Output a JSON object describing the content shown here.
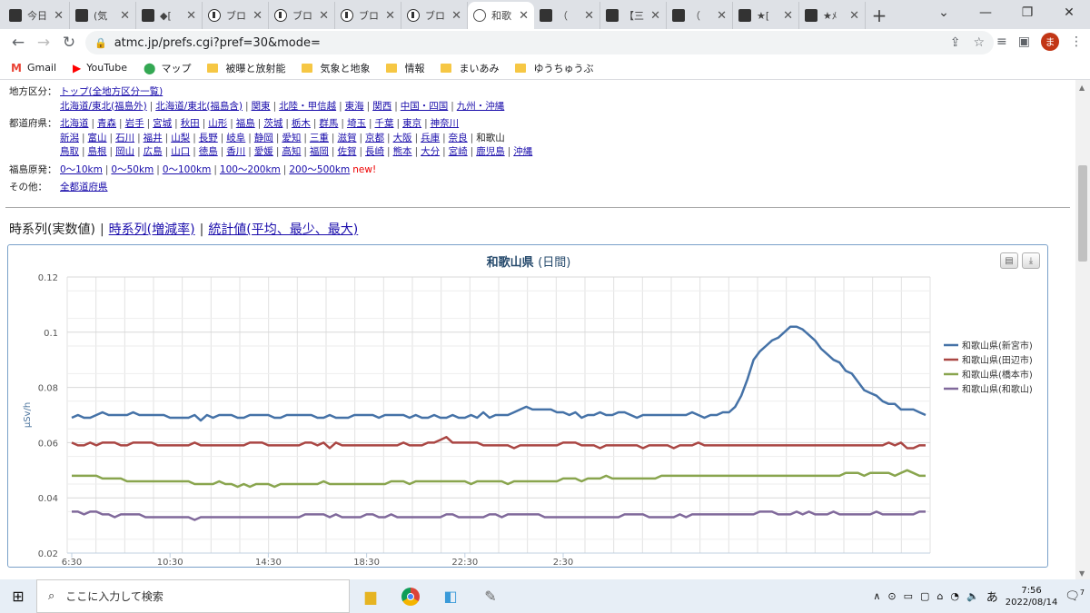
{
  "browser": {
    "tabs": [
      {
        "title": "今日",
        "icon": "site-icon"
      },
      {
        "title": "(気",
        "icon": "site-icon"
      },
      {
        "title": "◆[",
        "icon": "site-icon"
      },
      {
        "title": "ブロ",
        "icon": "blog-icon"
      },
      {
        "title": "ブロ",
        "icon": "blog-icon"
      },
      {
        "title": "ブロ",
        "icon": "blog-icon"
      },
      {
        "title": "ブロ",
        "icon": "blog-icon"
      },
      {
        "title": "和歌",
        "icon": "globe-icon",
        "active": true
      },
      {
        "title": "（",
        "icon": "site-icon"
      },
      {
        "title": "【三",
        "icon": "site-icon"
      },
      {
        "title": "（",
        "icon": "site-icon"
      },
      {
        "title": "★[",
        "icon": "site-icon"
      },
      {
        "title": "★ﾒ",
        "icon": "site-icon"
      }
    ],
    "url": "atmc.jp/prefs.cgi?pref=30&mode=",
    "profile_initial": "ま",
    "bookmarks": [
      {
        "label": "Gmail",
        "icon": "gmail-icon"
      },
      {
        "label": "YouTube",
        "icon": "youtube-icon"
      },
      {
        "label": "マップ",
        "icon": "maps-icon"
      },
      {
        "label": "被曝と放射能",
        "icon": "folder-icon"
      },
      {
        "label": "気象と地象",
        "icon": "folder-icon"
      },
      {
        "label": "情報",
        "icon": "folder-icon"
      },
      {
        "label": "まいあみ",
        "icon": "folder-icon"
      },
      {
        "label": "ゆうちゅうぶ",
        "icon": "folder-icon"
      }
    ]
  },
  "nav": {
    "region_label": "地方区分：",
    "region_row1": [
      "トップ(全地方区分一覧)"
    ],
    "region_row2": [
      "北海道/東北(福島外)",
      "北海道/東北(福島含)",
      "関東",
      "北陸・甲信越",
      "東海",
      "関西",
      "中国・四国",
      "九州・沖縄"
    ],
    "pref_label": "都道府県：",
    "pref_row1": [
      "北海道",
      "青森",
      "岩手",
      "宮城",
      "秋田",
      "山形",
      "福島",
      "茨城",
      "栃木",
      "群馬",
      "埼玉",
      "千葉",
      "東京",
      "神奈川"
    ],
    "pref_row2": [
      "新潟",
      "富山",
      "石川",
      "福井",
      "山梨",
      "長野",
      "岐阜",
      "静岡",
      "愛知",
      "三重",
      "滋賀",
      "京都",
      "大阪",
      "兵庫",
      "奈良"
    ],
    "pref_row2_current": "和歌山",
    "pref_row3": [
      "鳥取",
      "島根",
      "岡山",
      "広島",
      "山口",
      "徳島",
      "香川",
      "愛媛",
      "高知",
      "福岡",
      "佐賀",
      "長崎",
      "熊本",
      "大分",
      "宮崎",
      "鹿児島",
      "沖縄"
    ],
    "fukushima_label": "福島原発：",
    "fukushima_links": [
      "0〜10km",
      "0〜50km",
      "0〜100km",
      "100〜200km",
      "200〜500km"
    ],
    "new_label": "new!",
    "other_label": "その他：",
    "other_links": [
      "全都道府県"
    ]
  },
  "modes": {
    "current": "時系列(実数値)",
    "links": [
      "時系列(増減率)",
      "統計値(平均、最少、最大)"
    ]
  },
  "chart_data": {
    "type": "line",
    "title": "和歌山県",
    "subtitle": "(日間)",
    "ylabel": "μSv/h",
    "ylim": [
      0.02,
      0.12
    ],
    "yticks": [
      "0.02",
      "0.04",
      "0.06",
      "0.08",
      "0.1",
      "0.12"
    ],
    "xticks": [
      "6:30",
      "10:30",
      "14:30",
      "18:30",
      "22:30",
      "2:30"
    ],
    "colors": [
      "#4572a7",
      "#aa4643",
      "#89a54e",
      "#80699b"
    ],
    "legend_position": "right",
    "series": [
      {
        "name": "和歌山県(新宮市)",
        "values": [
          0.069,
          0.07,
          0.069,
          0.069,
          0.07,
          0.071,
          0.07,
          0.07,
          0.07,
          0.07,
          0.071,
          0.07,
          0.07,
          0.07,
          0.07,
          0.07,
          0.069,
          0.069,
          0.069,
          0.069,
          0.07,
          0.068,
          0.07,
          0.069,
          0.07,
          0.07,
          0.07,
          0.069,
          0.069,
          0.07,
          0.07,
          0.07,
          0.07,
          0.069,
          0.069,
          0.07,
          0.07,
          0.07,
          0.07,
          0.07,
          0.069,
          0.069,
          0.07,
          0.069,
          0.069,
          0.069,
          0.07,
          0.07,
          0.07,
          0.07,
          0.069,
          0.07,
          0.07,
          0.07,
          0.07,
          0.069,
          0.07,
          0.069,
          0.069,
          0.07,
          0.069,
          0.069,
          0.07,
          0.069,
          0.069,
          0.07,
          0.069,
          0.071,
          0.069,
          0.07,
          0.07,
          0.07,
          0.071,
          0.072,
          0.073,
          0.072,
          0.072,
          0.072,
          0.072,
          0.071,
          0.071,
          0.07,
          0.071,
          0.069,
          0.07,
          0.07,
          0.071,
          0.07,
          0.07,
          0.071,
          0.071,
          0.07,
          0.069,
          0.07,
          0.07,
          0.07,
          0.07,
          0.07,
          0.07,
          0.07,
          0.07,
          0.071,
          0.07,
          0.069,
          0.07,
          0.07,
          0.071,
          0.071,
          0.073,
          0.077,
          0.083,
          0.09,
          0.093,
          0.095,
          0.097,
          0.098,
          0.1,
          0.102,
          0.102,
          0.101,
          0.099,
          0.097,
          0.094,
          0.092,
          0.09,
          0.089,
          0.086,
          0.085,
          0.082,
          0.079,
          0.078,
          0.077,
          0.075,
          0.074,
          0.074,
          0.072,
          0.072,
          0.072,
          0.071,
          0.07
        ]
      },
      {
        "name": "和歌山県(田辺市)",
        "values": [
          0.06,
          0.059,
          0.059,
          0.06,
          0.059,
          0.06,
          0.06,
          0.06,
          0.059,
          0.059,
          0.06,
          0.06,
          0.06,
          0.06,
          0.059,
          0.059,
          0.059,
          0.059,
          0.059,
          0.059,
          0.06,
          0.059,
          0.059,
          0.059,
          0.059,
          0.059,
          0.059,
          0.059,
          0.059,
          0.06,
          0.06,
          0.06,
          0.059,
          0.059,
          0.059,
          0.059,
          0.059,
          0.059,
          0.06,
          0.06,
          0.059,
          0.06,
          0.058,
          0.06,
          0.059,
          0.059,
          0.059,
          0.059,
          0.059,
          0.059,
          0.059,
          0.059,
          0.059,
          0.059,
          0.06,
          0.059,
          0.059,
          0.059,
          0.06,
          0.06,
          0.061,
          0.062,
          0.06,
          0.06,
          0.06,
          0.06,
          0.06,
          0.059,
          0.059,
          0.059,
          0.059,
          0.059,
          0.058,
          0.059,
          0.059,
          0.059,
          0.059,
          0.059,
          0.059,
          0.059,
          0.06,
          0.06,
          0.06,
          0.059,
          0.059,
          0.059,
          0.058,
          0.059,
          0.059,
          0.059,
          0.059,
          0.059,
          0.059,
          0.058,
          0.059,
          0.059,
          0.059,
          0.059,
          0.058,
          0.059,
          0.059,
          0.059,
          0.06,
          0.059,
          0.059,
          0.059,
          0.059,
          0.059,
          0.059,
          0.059,
          0.059,
          0.059,
          0.059,
          0.059,
          0.059,
          0.059,
          0.059,
          0.059,
          0.059,
          0.059,
          0.059,
          0.059,
          0.059,
          0.059,
          0.059,
          0.059,
          0.059,
          0.059,
          0.059,
          0.059,
          0.059,
          0.059,
          0.059,
          0.06,
          0.059,
          0.06,
          0.058,
          0.058,
          0.059,
          0.059
        ]
      },
      {
        "name": "和歌山県(橋本市)",
        "values": [
          0.048,
          0.048,
          0.048,
          0.048,
          0.048,
          0.047,
          0.047,
          0.047,
          0.047,
          0.046,
          0.046,
          0.046,
          0.046,
          0.046,
          0.046,
          0.046,
          0.046,
          0.046,
          0.046,
          0.046,
          0.045,
          0.045,
          0.045,
          0.045,
          0.046,
          0.045,
          0.045,
          0.044,
          0.045,
          0.044,
          0.045,
          0.045,
          0.045,
          0.044,
          0.045,
          0.045,
          0.045,
          0.045,
          0.045,
          0.045,
          0.045,
          0.046,
          0.045,
          0.045,
          0.045,
          0.045,
          0.045,
          0.045,
          0.045,
          0.045,
          0.045,
          0.045,
          0.046,
          0.046,
          0.046,
          0.045,
          0.046,
          0.046,
          0.046,
          0.046,
          0.046,
          0.046,
          0.046,
          0.046,
          0.046,
          0.045,
          0.046,
          0.046,
          0.046,
          0.046,
          0.046,
          0.045,
          0.046,
          0.046,
          0.046,
          0.046,
          0.046,
          0.046,
          0.046,
          0.046,
          0.047,
          0.047,
          0.047,
          0.046,
          0.047,
          0.047,
          0.047,
          0.048,
          0.047,
          0.047,
          0.047,
          0.047,
          0.047,
          0.047,
          0.047,
          0.047,
          0.048,
          0.048,
          0.048,
          0.048,
          0.048,
          0.048,
          0.048,
          0.048,
          0.048,
          0.048,
          0.048,
          0.048,
          0.048,
          0.048,
          0.048,
          0.048,
          0.048,
          0.048,
          0.048,
          0.048,
          0.048,
          0.048,
          0.048,
          0.048,
          0.048,
          0.048,
          0.048,
          0.048,
          0.048,
          0.048,
          0.049,
          0.049,
          0.049,
          0.048,
          0.049,
          0.049,
          0.049,
          0.049,
          0.048,
          0.049,
          0.05,
          0.049,
          0.048,
          0.048
        ]
      },
      {
        "name": "和歌山県(和歌山)",
        "values": [
          0.035,
          0.035,
          0.034,
          0.035,
          0.035,
          0.034,
          0.034,
          0.033,
          0.034,
          0.034,
          0.034,
          0.034,
          0.033,
          0.033,
          0.033,
          0.033,
          0.033,
          0.033,
          0.033,
          0.033,
          0.032,
          0.033,
          0.033,
          0.033,
          0.033,
          0.033,
          0.033,
          0.033,
          0.033,
          0.033,
          0.033,
          0.033,
          0.033,
          0.033,
          0.033,
          0.033,
          0.033,
          0.033,
          0.034,
          0.034,
          0.034,
          0.034,
          0.033,
          0.034,
          0.033,
          0.033,
          0.033,
          0.033,
          0.034,
          0.034,
          0.033,
          0.033,
          0.034,
          0.033,
          0.033,
          0.033,
          0.033,
          0.033,
          0.033,
          0.033,
          0.033,
          0.034,
          0.034,
          0.033,
          0.033,
          0.033,
          0.033,
          0.033,
          0.034,
          0.034,
          0.033,
          0.034,
          0.034,
          0.034,
          0.034,
          0.034,
          0.034,
          0.033,
          0.033,
          0.033,
          0.033,
          0.033,
          0.033,
          0.033,
          0.033,
          0.033,
          0.033,
          0.033,
          0.033,
          0.033,
          0.034,
          0.034,
          0.034,
          0.034,
          0.033,
          0.033,
          0.033,
          0.033,
          0.033,
          0.034,
          0.033,
          0.034,
          0.034,
          0.034,
          0.034,
          0.034,
          0.034,
          0.034,
          0.034,
          0.034,
          0.034,
          0.034,
          0.035,
          0.035,
          0.035,
          0.034,
          0.034,
          0.034,
          0.035,
          0.034,
          0.035,
          0.034,
          0.034,
          0.034,
          0.035,
          0.034,
          0.034,
          0.034,
          0.034,
          0.034,
          0.034,
          0.035,
          0.034,
          0.034,
          0.034,
          0.034,
          0.034,
          0.034,
          0.035,
          0.035
        ]
      }
    ]
  },
  "taskbar": {
    "search_placeholder": "ここに入力して検索",
    "ime": "あ",
    "time": "7:56",
    "date": "2022/08/14",
    "notifications": "7"
  }
}
